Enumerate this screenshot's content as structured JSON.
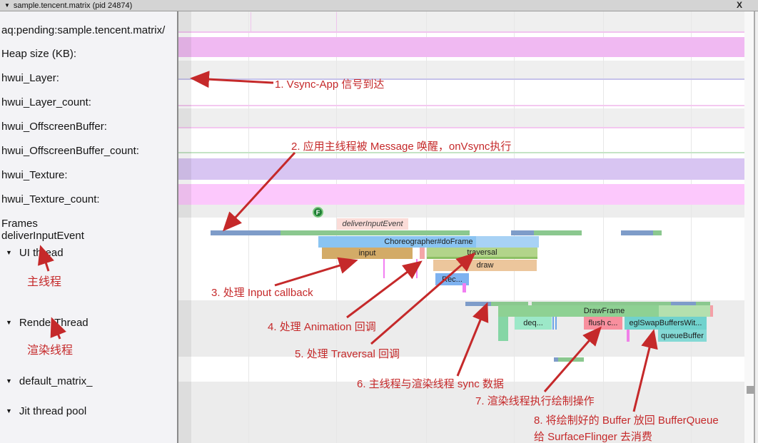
{
  "header": {
    "title": "sample.tencent.matrix (pid 24874)",
    "close": "X"
  },
  "icons": {
    "collapse": "▼"
  },
  "sidebar": {
    "counter_tracks": [
      "aq:pending:sample.tencent.matrix/",
      "Heap size (KB):",
      "hwui_Layer:",
      "hwui_Layer_count:",
      "hwui_OffscreenBuffer:",
      "hwui_OffscreenBuffer_count:",
      "hwui_Texture:",
      "hwui_Texture_count:",
      "Frames",
      "deliverInputEvent"
    ],
    "threads": [
      {
        "label": "UI thread",
        "note": "主线程"
      },
      {
        "label": "RenderThread",
        "note": "渲染线程"
      },
      {
        "label": "default_matrix_",
        "note": ""
      },
      {
        "label": "Jit thread pool",
        "note": ""
      }
    ]
  },
  "timeline": {
    "frame_marker_label": "F",
    "slices": {
      "deliver_input_event": "deliverInputEvent",
      "choreographer": "Choreographer#doFrame",
      "input": "input",
      "traversal": "traversal",
      "draw": "draw",
      "record": "Rec...",
      "draw_frame": "DrawFrame",
      "dequeue_buffer": "deq...",
      "flush": "flush c...",
      "egl_swap_buffers": "eglSwapBuffersWit...",
      "queue_buffer": "queueBuffer"
    }
  },
  "annotations": [
    {
      "step": "1",
      "text": "1. Vsync-App 信号到达"
    },
    {
      "step": "2",
      "text": "2. 应用主线程被 Message 唤醒，onVsync执行"
    },
    {
      "step": "3",
      "text": "3. 处理 Input callback"
    },
    {
      "step": "4",
      "text": "4. 处理 Animation 回调"
    },
    {
      "step": "5",
      "text": "5. 处理 Traversal 回调"
    },
    {
      "step": "6",
      "text": "6. 主线程与渲染线程 sync 数据"
    },
    {
      "step": "7",
      "text": "7. 渲染线程执行绘制操作"
    },
    {
      "step": "8",
      "text": "8. 将绘制好的 Buffer 放回 BufferQueue",
      "text2": "给 SurfaceFlinger 去消费"
    }
  ],
  "colors": {
    "annotation_red": "#c5292a",
    "choreographer": "#8ac4f2",
    "input": "#d3ab67",
    "animation_sliver": "#f4a6a8",
    "traversal": "#b2d48a",
    "draw": "#ecc69c",
    "record": "#7eb2f0",
    "draw_frame": "#8ed193",
    "dequeue_buffer": "#9ce8c8",
    "flush": "#f88f9e",
    "egl_swap_buffers": "#70d2cd",
    "queue_buffer": "#84d9d5",
    "run_state_blue": "#7e9cc9",
    "run_state_green": "#8bc88f",
    "heap_band": "#f0b9f2",
    "texture_band": "#d8c5f2",
    "texture_count_band": "#fcc8fc",
    "deliver_slice": "#fbdcd8",
    "frame_marker_green": "#1e7e34"
  }
}
